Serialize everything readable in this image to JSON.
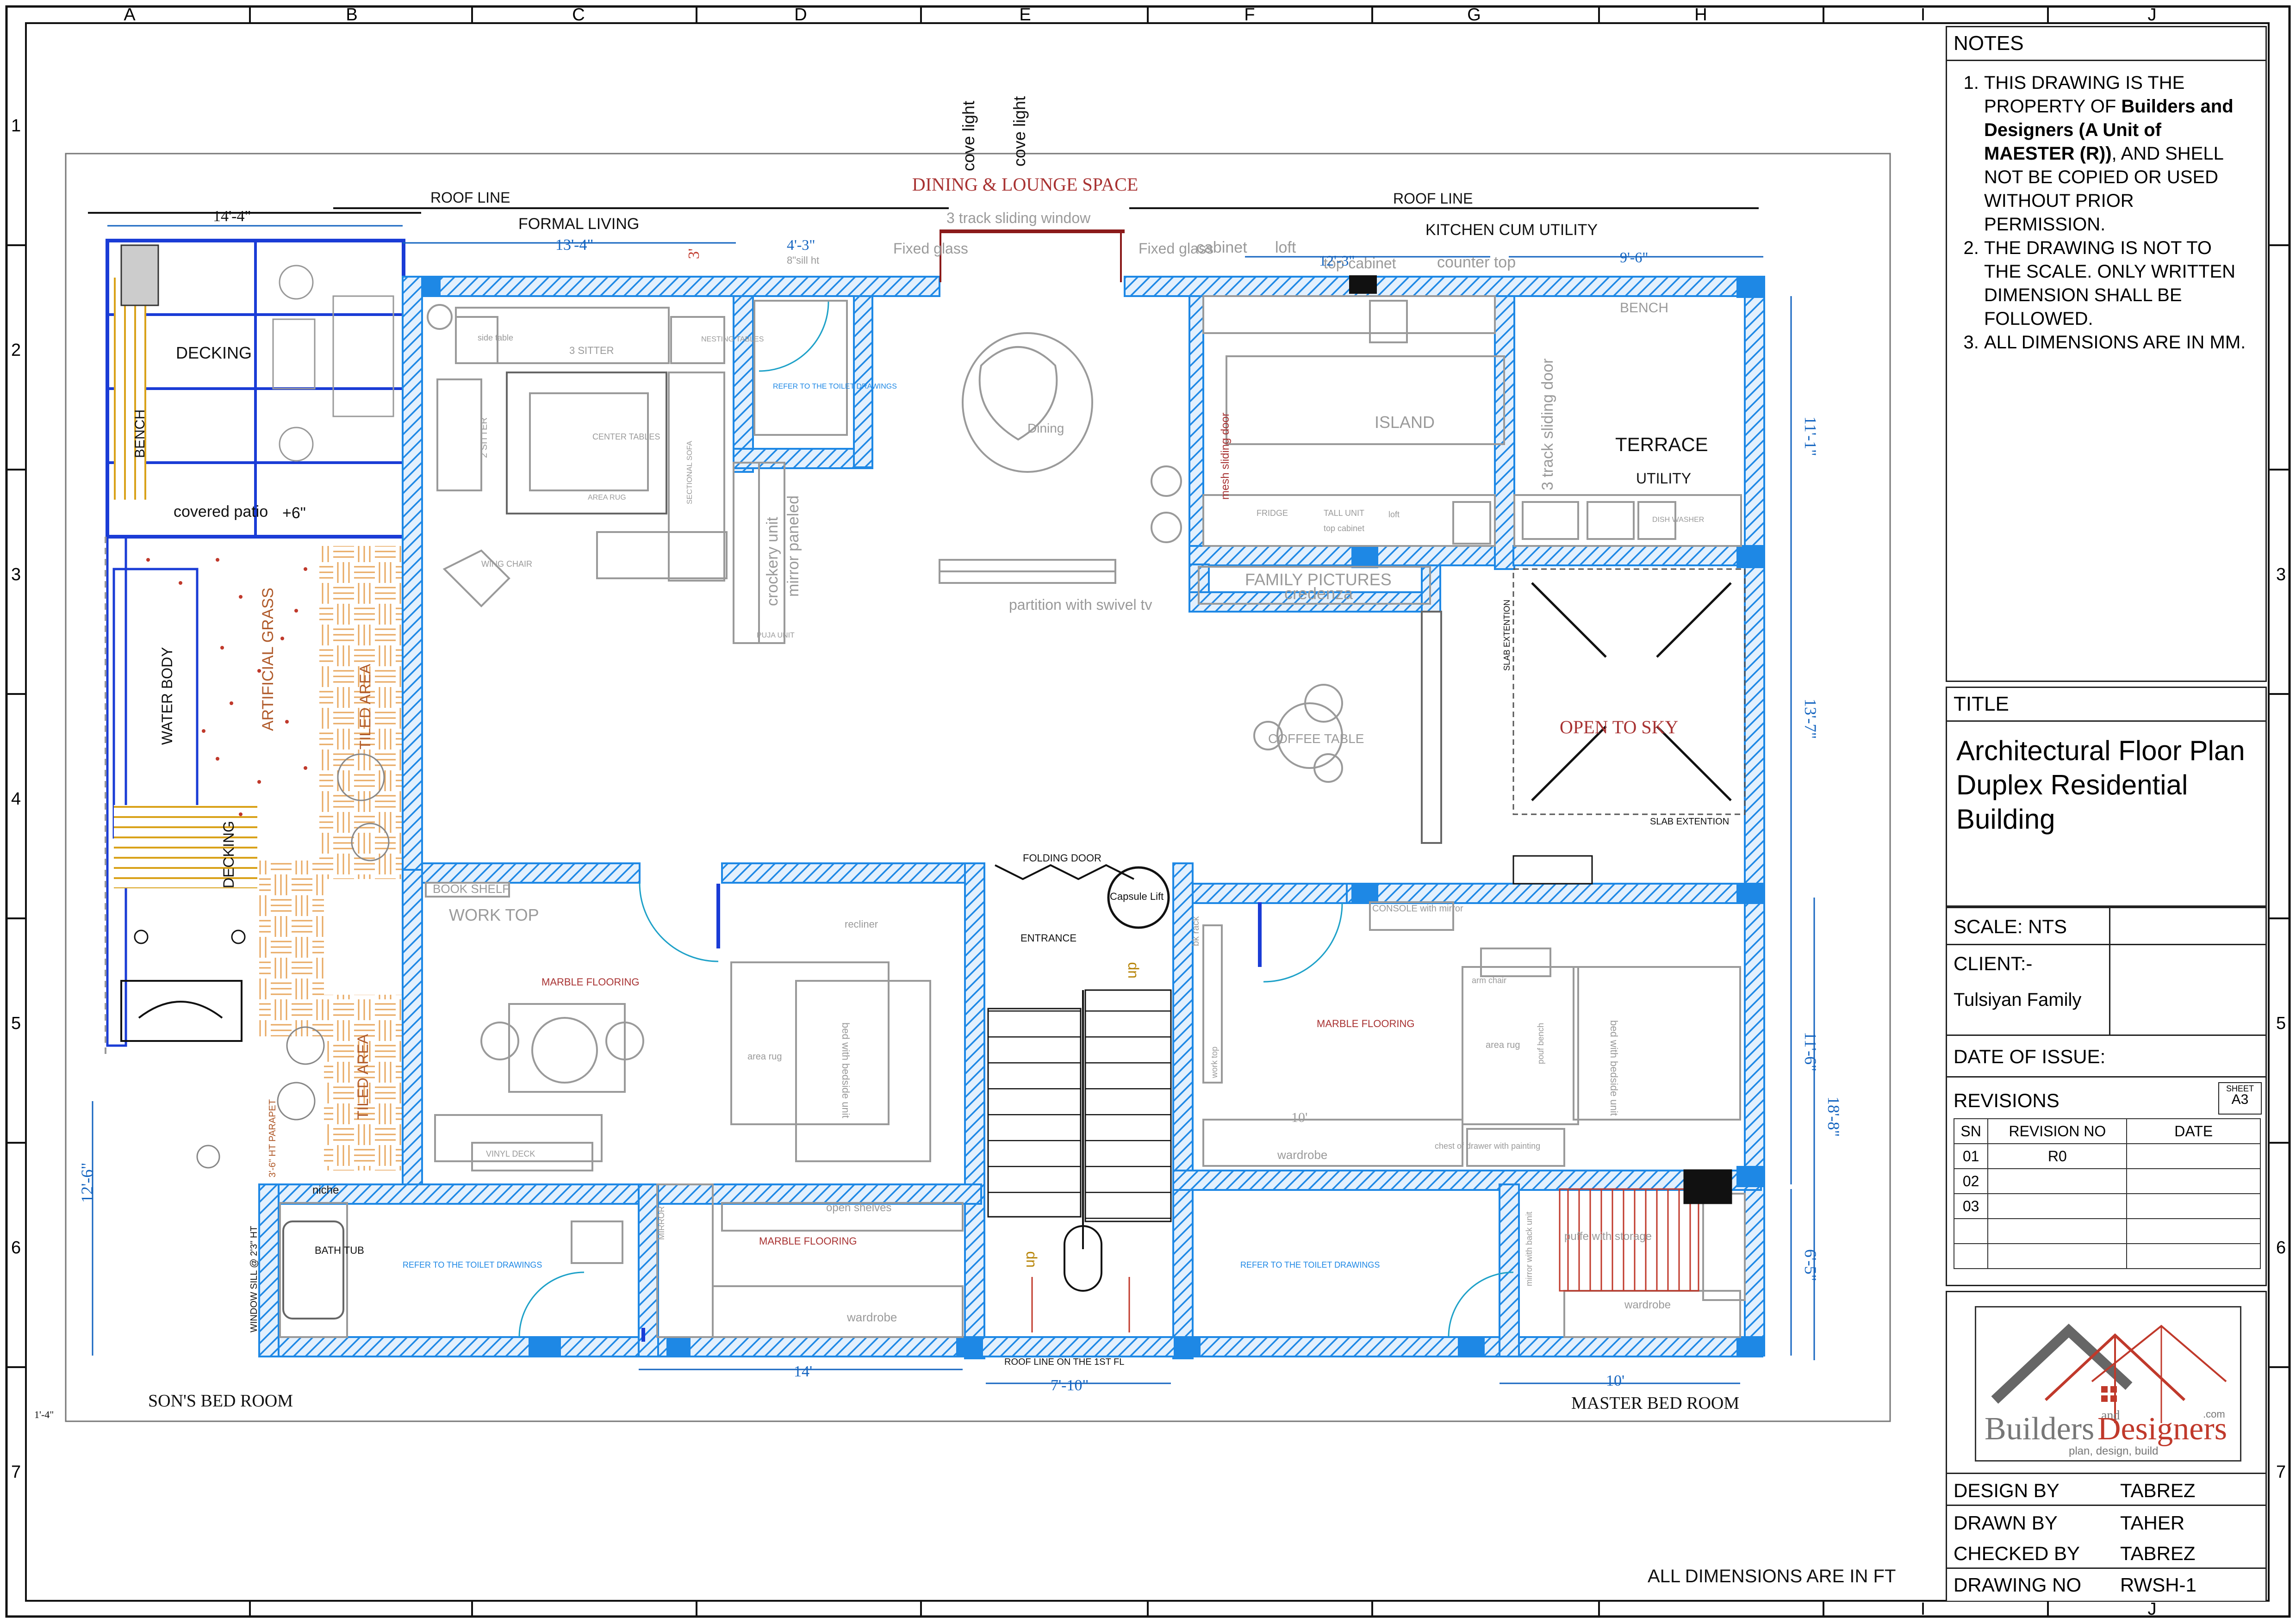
{
  "grid": {
    "columns": [
      "A",
      "B",
      "C",
      "D",
      "E",
      "F",
      "G",
      "H",
      "I",
      "J"
    ],
    "rows": [
      "1",
      "2",
      "3",
      "4",
      "5",
      "6",
      "7"
    ]
  },
  "plan_labels": {
    "dining_lounge": "DINING & LOUNGE SPACE",
    "roof_line_left": "ROOF LINE",
    "roof_line_right": "ROOF LINE",
    "formal_living": "FORMAL LIVING",
    "kitchen_utility": "KITCHEN CUM UTILITY",
    "cove_light_1": "cove light",
    "cove_light_2": "cove light",
    "sliding_window": "3 track sliding window",
    "fixed_glass_1": "Fixed glass",
    "fixed_glass_2": "Fixed glass",
    "cabinet": "cabinet",
    "loft": "loft",
    "top_cabinet": "top cabinet",
    "counter_top": "counter top",
    "sill_ht": "8\"sill ht",
    "decking_1": "DECKING",
    "bench_1": "BENCH",
    "covered_patio": "covered patio",
    "plus6": "+6\"",
    "water_body": "WATER BODY",
    "artificial_grass": "ARTIFICIAL GRASS",
    "tiled_area_1": "TILED AREA",
    "tiled_area_2": "TILED AREA",
    "decking_2": "DECKING",
    "three_sitter": "3 SITTER",
    "two_sitter": "2 SITTER",
    "center_tables": "CENTER TABLES",
    "area_rug": "AREA RUG",
    "nesting_tables": "NESTING TABLES",
    "sectional_sofa": "SECTIONAL SOFA",
    "wing_chair": "WING CHAIR",
    "side_table": "side table",
    "toilet_ref_1": "REFER TO THE TOILET DRAWINGS",
    "crockery_unit": "crockery unit",
    "mirror_paneled": "mirror paneled",
    "puja_unit": "PUJA UNIT",
    "dining": "Dining",
    "partition_tv": "partition with swivel tv",
    "mesh_door": "mesh sliding door",
    "island": "ISLAND",
    "fridge": "FRIDGE",
    "tall_unit": "TALL UNIT",
    "loft2": "loft",
    "top_cabinet2": "top cabinet",
    "three_track_door": "3 track sliding door",
    "terrace": "TERRACE",
    "utility": "UTILITY",
    "bench_2": "BENCH",
    "dish_washer": "DISH WASHER",
    "family_pictures": "FAMILY PICTURES",
    "credenza": "credenza",
    "coffee_table": "COFFEE TABLE",
    "open_to_sky": "OPEN TO SKY",
    "slab_ext_1": "SLAB EXTENTION",
    "slab_ext_2": "SLAB EXTENTION",
    "folding_door": "FOLDING DOOR",
    "capsule_lift": "Capsule Lift",
    "entrance": "ENTRANCE",
    "up_1": "up",
    "up_2": "up",
    "book_shelf": "BOOK SHELF",
    "work_top": "WORK TOP",
    "recliner": "recliner",
    "marble_1": "MARBLE FLOORING",
    "area_rug_2": "area rug",
    "bed_1": "bed with bedside unit",
    "vinyl_deck": "VINYL DECK",
    "bk_rack": "bk rack",
    "console": "CONSOLE with mirror",
    "work_top_2": "work top",
    "marble_2": "MARBLE FLOORING",
    "arm_chair": "arm chair",
    "area_rug_3": "area rug",
    "pouf_bench": "pouf bench",
    "bed_2": "bed with bedside unit",
    "wardrobe_1": "wardrobe",
    "chest_drawer": "chest of drawer with painting",
    "niche": "niche",
    "bath_tub": "BATH TUB",
    "toilet_ref_2": "REFER TO THE TOILET DRAWINGS",
    "mirror_label": "MIRROR",
    "open_shelves": "open shelves",
    "marble_3": "MARBLE FLOORING",
    "wardrobe_2": "wardrobe",
    "toilet_ref_3": "REFER TO THE TOILET DRAWINGS",
    "mirror_back_unit": "mirror with back unit",
    "puffe": "puffe with storage",
    "wardrobe_3": "wardrobe",
    "window_sill": "WINDOW SILL @ 2'3\" HT",
    "parapet": "3'-6\" HT PARAPET",
    "roof_line_1st": "ROOF LINE ON THE 1ST FL",
    "son_bed": "SON'S BED ROOM",
    "master_bed": "MASTER BED ROOM",
    "all_dims_ft": "ALL DIMENSIONS ARE IN  FT"
  },
  "dimensions": {
    "d_14_4": "14'-4\"",
    "d_13_4": "13'-4\"",
    "d_3": "3'",
    "d_4_3": "4'-3\"",
    "d_12_3": "12'-3\"",
    "d_9_6": "9'-6\"",
    "d_11_1": "11'-1\"",
    "d_13_7": "13'-7\"",
    "d_11_6": "11'-6\"",
    "d_18_8": "18'-8\"",
    "d_6_5": "6'-5\"",
    "d_12_6": "12'-6\"",
    "d_14": "14'",
    "d_7_10": "7'-10\"",
    "d_10a": "10'",
    "d_10b": "10'",
    "d_1_4": "1'-4\""
  },
  "notes": {
    "header": "NOTES",
    "n1_a": "THIS DRAWING IS THE PROPERTY OF ",
    "n1_b": "Builders and Designers (A Unit of MAESTER (R))",
    "n1_c": ",  AND SHELL NOT BE COPIED OR USED WITHOUT PRIOR PERMISSION.",
    "n2": "THE DRAWING  IS NOT TO THE SCALE. ONLY WRITTEN DIMENSION SHALL BE FOLLOWED.",
    "n3": "ALL DIMENSIONS ARE IN MM."
  },
  "title_block": {
    "header": "TITLE",
    "line1": "Architectural Floor Plan",
    "line2": "Duplex Residential",
    "line3": "Building",
    "scale": "SCALE: NTS",
    "client_label": "CLIENT:-",
    "client": "Tulsiyan Family",
    "date_issue": "DATE OF ISSUE:",
    "revisions": "REVISIONS",
    "sheet_label": "SHEET",
    "sheet": "A3",
    "rev_headers": [
      "SN",
      "REVISION NO",
      "DATE"
    ],
    "rev_rows": [
      [
        "01",
        "R0",
        ""
      ],
      [
        "02",
        "",
        ""
      ],
      [
        "03",
        "",
        ""
      ],
      [
        "",
        "",
        ""
      ],
      [
        "",
        "",
        ""
      ]
    ],
    "logo_text_a": "Builders",
    "logo_and": "and",
    "logo_text_b": "Designers",
    "logo_com": ".com",
    "logo_tag": "plan, design, build",
    "design_by_label": "DESIGN BY",
    "design_by": "TABREZ",
    "drawn_by_label": "DRAWN BY",
    "drawn_by": "TAHER",
    "checked_by_label": "CHECKED BY",
    "checked_by": "TABREZ",
    "drawing_no_label": "DRAWING NO",
    "drawing_no": "RWSH-1"
  },
  "colors": {
    "wall": "#1e88e5",
    "wall_fill": "#cfe3fa",
    "furniture": "#9a9a9a",
    "label_dark": "#111111",
    "label_red": "#a83232",
    "label_brown": "#b05a2a",
    "tile": "#e8a860",
    "deck_stripe": "#d9a21a",
    "dim_blue": "#1565c0",
    "dim_grey": "#777777",
    "toilet_ref": "#1e88e5",
    "logo_red": "#c0392b",
    "logo_grey": "#666666"
  }
}
